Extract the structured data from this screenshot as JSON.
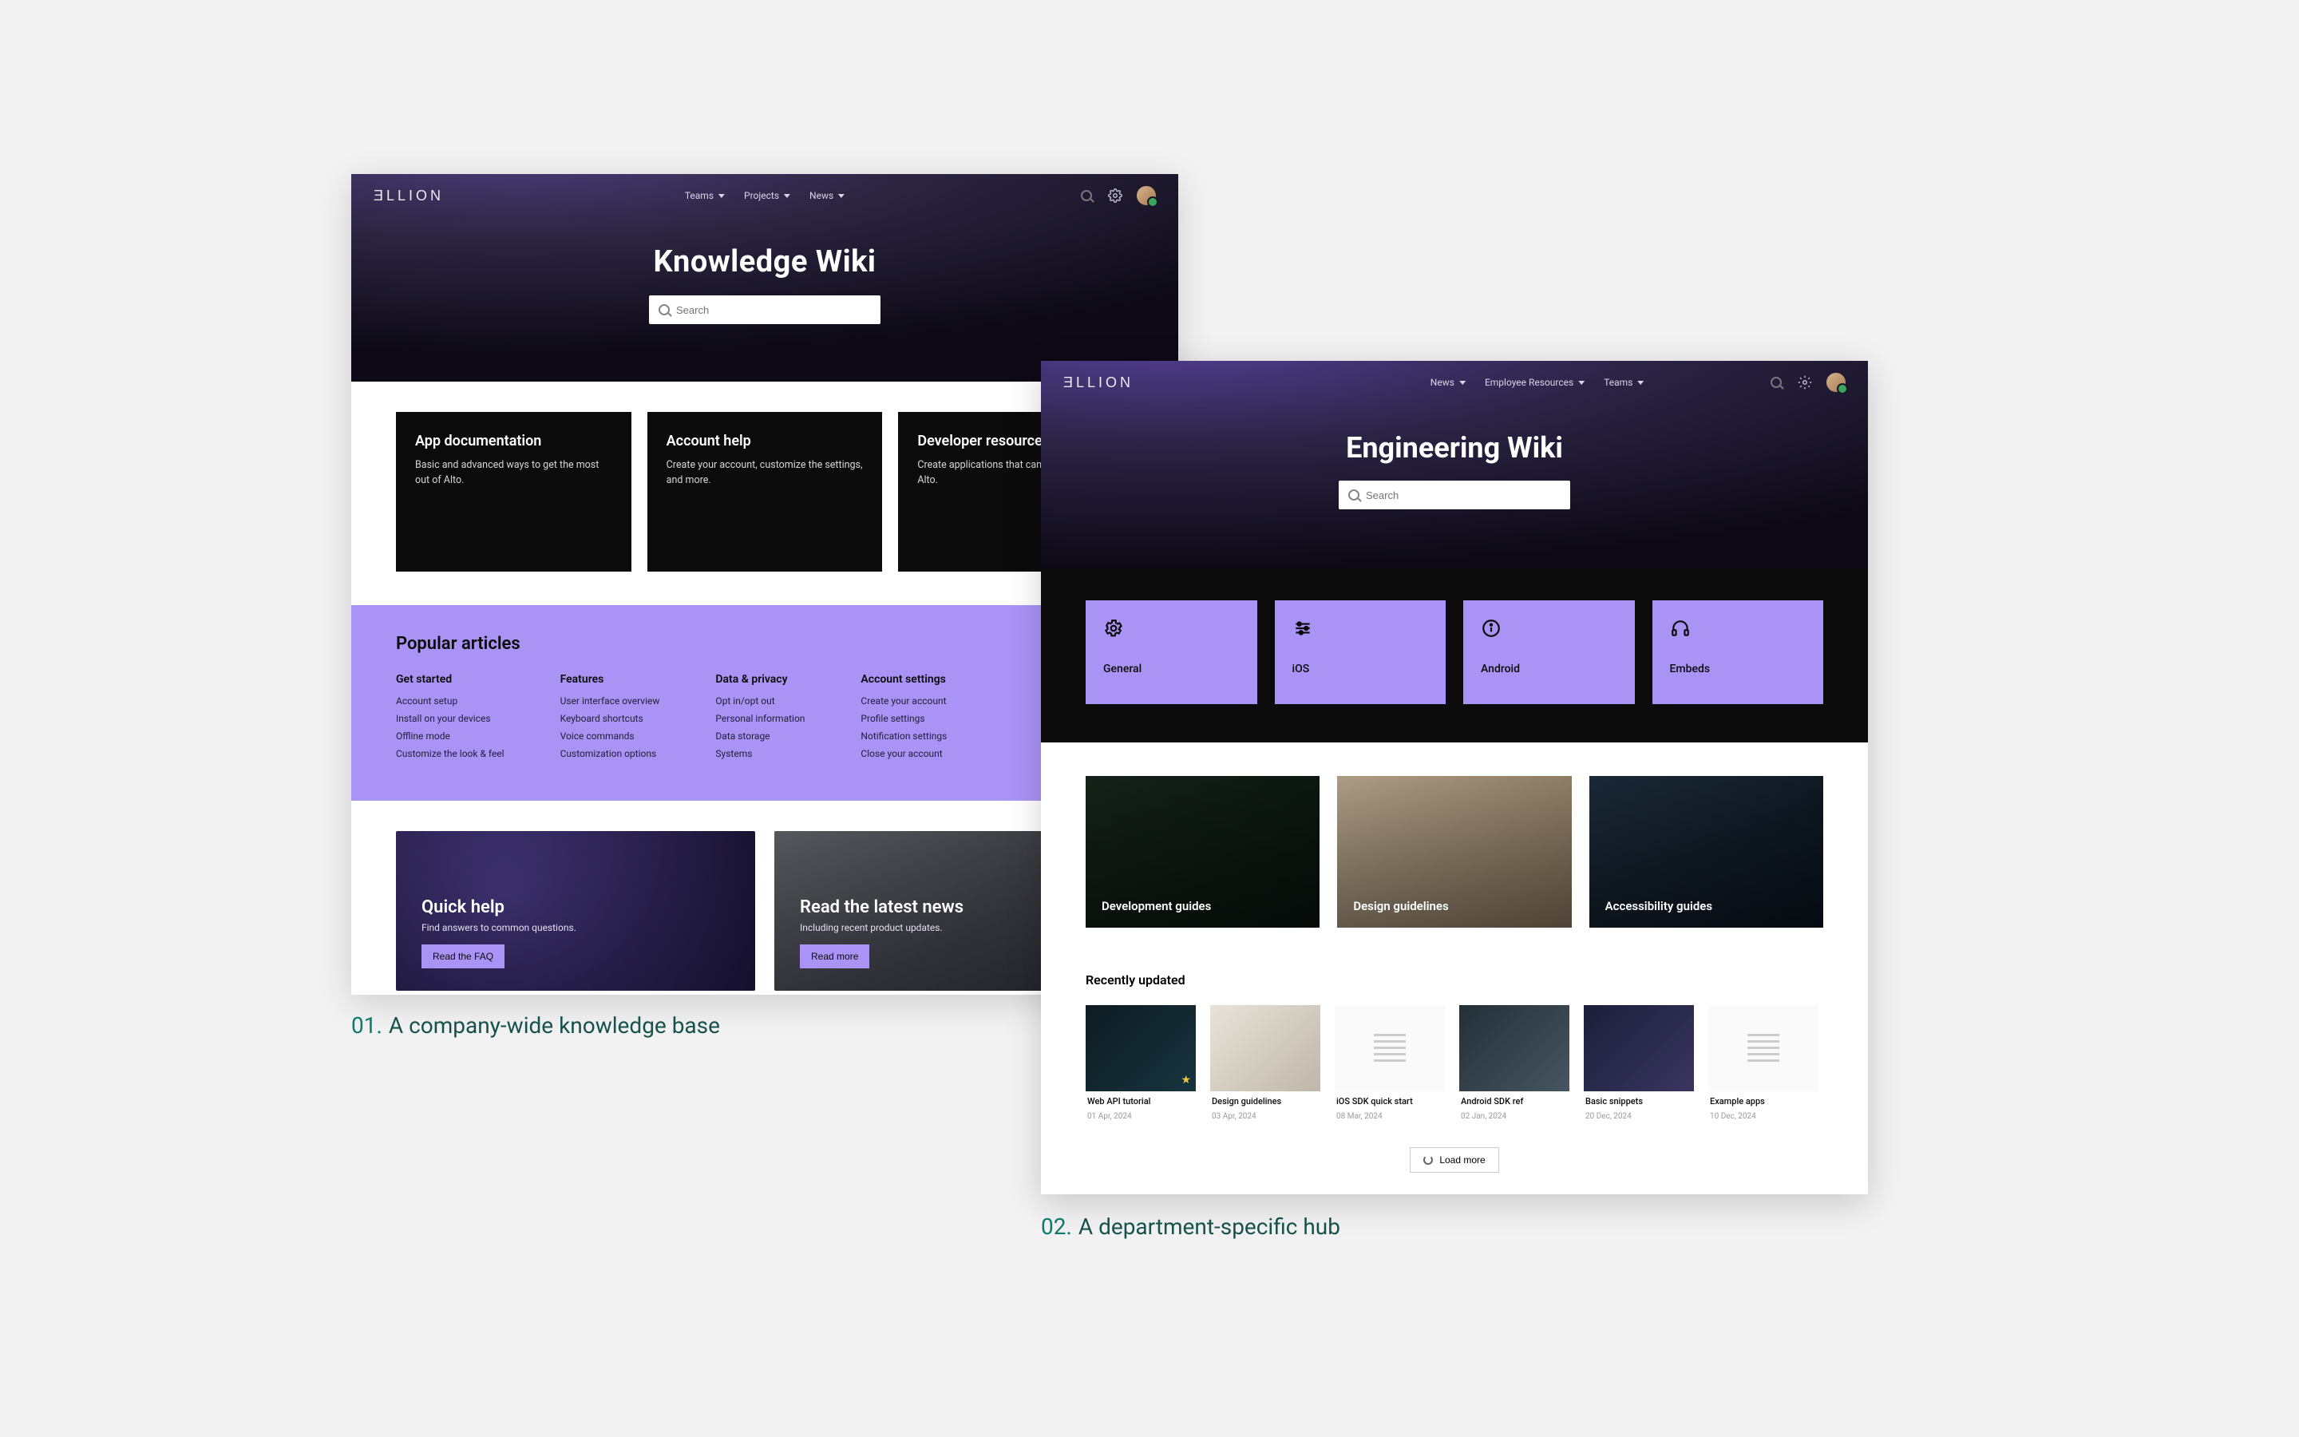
{
  "brand": "ƎLLION",
  "colors": {
    "lilac": "#a993f5",
    "teal": "#0a7a6c"
  },
  "panelA": {
    "nav": {
      "items": [
        {
          "label": "Teams"
        },
        {
          "label": "Projects"
        },
        {
          "label": "News"
        }
      ]
    },
    "title": "Knowledge Wiki",
    "search_placeholder": "Search",
    "tiles": [
      {
        "title": "App documentation",
        "desc": "Basic and advanced ways to get the most out of Alto."
      },
      {
        "title": "Account help",
        "desc": "Create your account, customize the settings, and more."
      },
      {
        "title": "Developer resources",
        "desc": "Create applications that can interact with Alto."
      }
    ],
    "popular_heading": "Popular articles",
    "popular": [
      {
        "heading": "Get started",
        "links": [
          "Account setup",
          "Install on your devices",
          "Offline mode",
          "Customize the look & feel"
        ]
      },
      {
        "heading": "Features",
        "links": [
          "User interface overview",
          "Keyboard shortcuts",
          "Voice commands",
          "Customization options"
        ]
      },
      {
        "heading": "Data & privacy",
        "links": [
          "Opt in/opt out",
          "Personal information",
          "Data storage",
          "Systems"
        ]
      },
      {
        "heading": "Account settings",
        "links": [
          "Create your account",
          "Profile settings",
          "Notification settings",
          "Close your account"
        ]
      }
    ],
    "bottom": [
      {
        "title": "Quick help",
        "desc": "Find answers to common questions.",
        "button": "Read the FAQ"
      },
      {
        "title": "Read the latest news",
        "desc": "Including recent product updates.",
        "button": "Read more"
      }
    ]
  },
  "panelB": {
    "nav": {
      "items": [
        {
          "label": "News"
        },
        {
          "label": "Employee Resources"
        },
        {
          "label": "Teams"
        }
      ]
    },
    "title": "Engineering Wiki",
    "search_placeholder": "Search",
    "categories": [
      {
        "label": "General",
        "icon": "gear"
      },
      {
        "label": "iOS",
        "icon": "sliders"
      },
      {
        "label": "Android",
        "icon": "info"
      },
      {
        "label": "Embeds",
        "icon": "headphones"
      }
    ],
    "guides": [
      {
        "label": "Development guides"
      },
      {
        "label": "Design guidelines"
      },
      {
        "label": "Accessibility guides"
      }
    ],
    "recent_heading": "Recently updated",
    "recent": [
      {
        "title": "Web API tutorial",
        "date": "01 Apr, 2024",
        "starred": true
      },
      {
        "title": "Design guidelines",
        "date": "03 Apr, 2024"
      },
      {
        "title": "iOS SDK quick start",
        "date": "08 Mar, 2024"
      },
      {
        "title": "Android SDK ref",
        "date": "02 Jan, 2024"
      },
      {
        "title": "Basic snippets",
        "date": "20 Dec, 2024"
      },
      {
        "title": "Example apps",
        "date": "10 Dec, 2024"
      }
    ],
    "load_more": "Load more"
  },
  "captions": {
    "a_num": "01.",
    "a_text": "A company-wide knowledge base",
    "b_num": "02.",
    "b_text": "A department-specific hub"
  }
}
